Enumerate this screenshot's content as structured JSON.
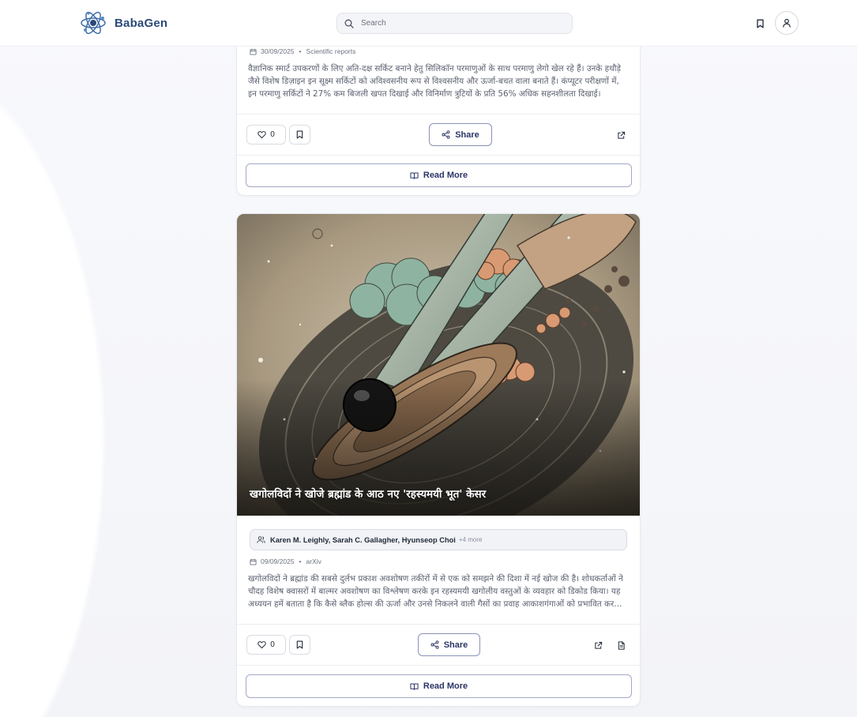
{
  "app": {
    "name": "BabaGen"
  },
  "search": {
    "placeholder": "Search"
  },
  "articles": [
    {
      "date": "30/09/2025",
      "source": "Scientific reports",
      "summary": "वैज्ञानिक स्मार्ट उपकरणों के लिए अति-दक्ष सर्किट बनाने हेतु सिलिकॉन परमाणुओं के साथ परमाणु लेगो खेल रहे हैं। उनके हथौड़े जैसे विशेष डिज़ाइन इन सूक्ष्म सर्किटों को अविश्वसनीय रूप से विश्वसनीय और ऊर्जा-बचत वाला बनाते हैं। कंप्यूटर परीक्षणों में, इन परमाणु सर्किटों ने 27% कम बिजली खपत दिखाई और विनिर्माण त्रुटियों के प्रति 56% अधिक सहनशीलता दिखाई।",
      "likes": "0",
      "share_label": "Share",
      "read_more_label": "Read More"
    },
    {
      "title": "खगोलविदों ने खोजे ब्रह्मांड के आठ नए 'रहस्यमयी भूत' केसर",
      "authors": "Karen M. Leighly, Sarah C. Gallagher, Hyunseop Choi",
      "authors_more": "+4 more",
      "date": "09/09/2025",
      "source": "arXiv",
      "summary": "खगोलविदों ने ब्रह्मांड की सबसे दुर्लभ प्रकाश अवशोषण तकीरों में से एक को समझने की दिशा में नई खोज की है। शोधकर्ताओं ने चौदह विशेष क्वासरों में बाल्मर अवशोषण का विश्लेषण करके इन रहस्यमयी खगोलीय वस्तुओं के व्यवहार को डिकोड किया। यह अध्ययन हमें बताता है कि कैसे ब्लैक होल्स की ऊर्जा और उनसे निकलने वाली गैसों का प्रवाह आकाशगंगाओं को प्रभावित करता है।",
      "likes": "0",
      "share_label": "Share",
      "read_more_label": "Read More"
    }
  ],
  "icons": {
    "logo": "atom-logo-icon",
    "search": "search-icon",
    "bookmark": "bookmark-icon",
    "user": "user-icon",
    "calendar": "calendar-icon",
    "heart": "heart-icon",
    "share": "share-icon",
    "external": "external-link-icon",
    "pdf": "document-icon",
    "book": "book-open-icon",
    "users": "users-icon"
  },
  "colors": {
    "brand": "#2b4a7a",
    "accent": "#2c3566",
    "border": "#d9dce3"
  }
}
